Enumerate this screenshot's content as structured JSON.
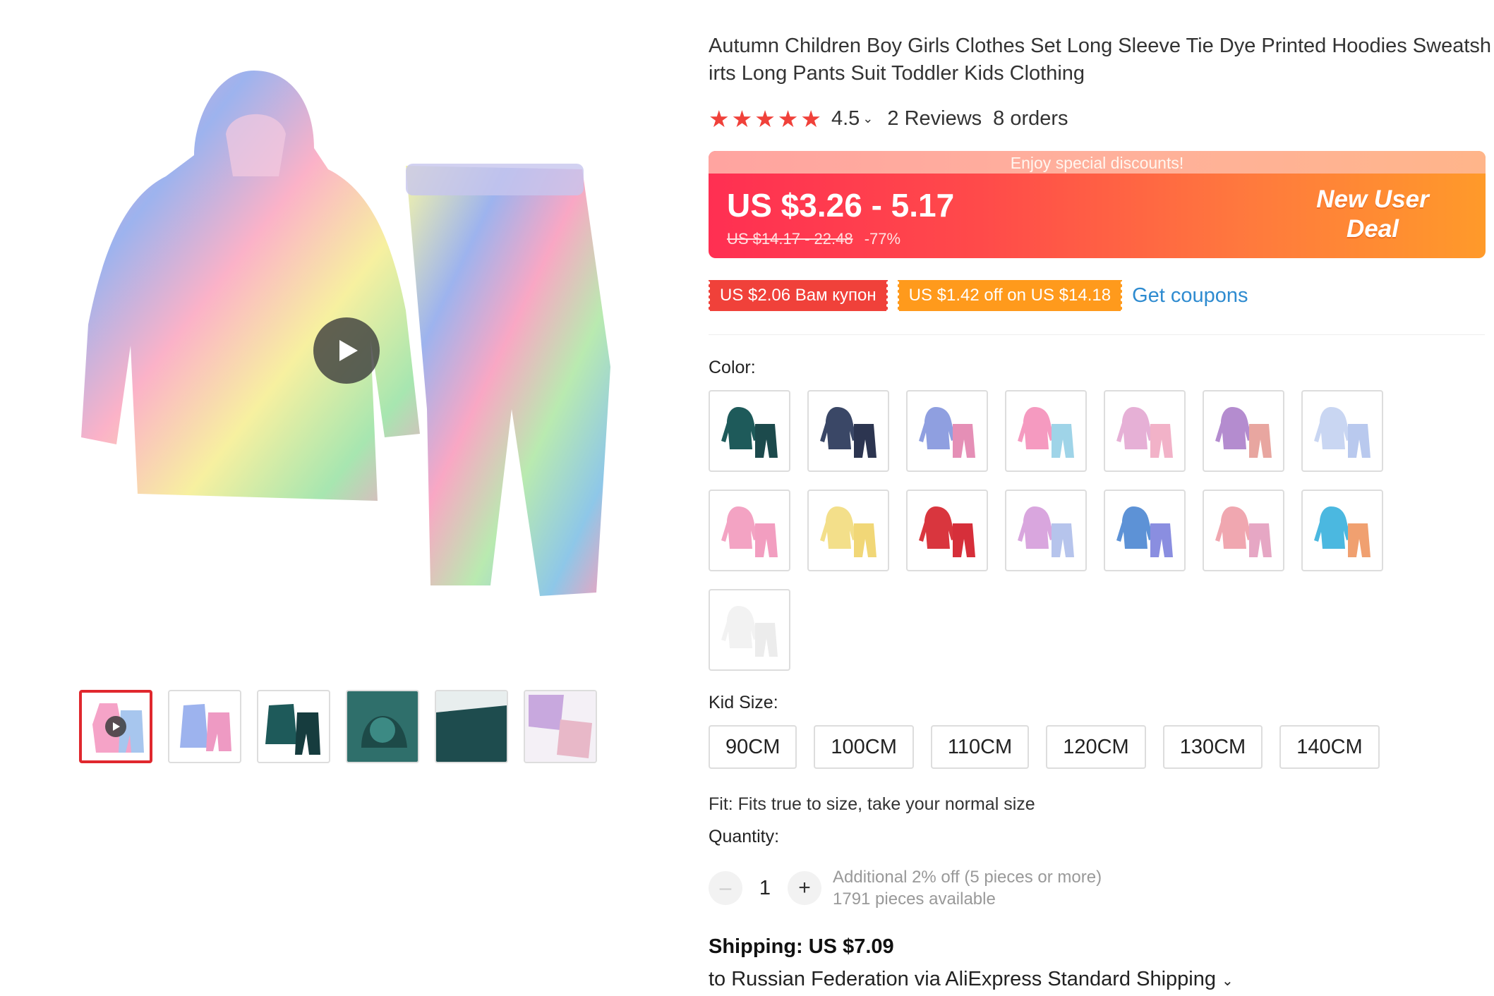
{
  "product": {
    "title_line1": "Autumn Children Boy Girls Clothes Set Long Sleeve Tie Dye Printed Hoodies Sweatsh",
    "title_line2": "irts Long Pants Suit Toddler Kids Clothing"
  },
  "rating": {
    "value": "4.5",
    "stars": 5,
    "reviews": "2 Reviews",
    "orders": "8 orders"
  },
  "price": {
    "banner_top": "Enjoy special discounts!",
    "current": "US $3.26 - 5.17",
    "original": "US $14.17 - 22.48",
    "discount": "-77%",
    "badge_line1": "New User",
    "badge_line2": "Deal"
  },
  "coupons": {
    "coupon1": "US $2.06 Вам купон",
    "coupon2": "US $1.42 off on US $14.18",
    "get_coupons": "Get coupons"
  },
  "color": {
    "label": "Color:",
    "swatches": [
      {
        "name": "dark-green",
        "hood": "#1e5a5a",
        "pants": "#1c4a4c"
      },
      {
        "name": "navy",
        "hood": "#3a4766",
        "pants": "#2c3550"
      },
      {
        "name": "blue-pink",
        "hood": "#8f9fe0",
        "pants": "#e58fb6"
      },
      {
        "name": "rainbow",
        "hood": "#f59ac0",
        "pants": "#9fd4e8"
      },
      {
        "name": "pastel-pink",
        "hood": "#e6b0d6",
        "pants": "#f2b2c8"
      },
      {
        "name": "purple-pink",
        "hood": "#b48ccf",
        "pants": "#e8a6a0"
      },
      {
        "name": "light-blue",
        "hood": "#c9d6f2",
        "pants": "#b9c9ee"
      },
      {
        "name": "pink",
        "hood": "#f3a3c3",
        "pants": "#f29ec0"
      },
      {
        "name": "yellow",
        "hood": "#f3df8a",
        "pants": "#f1d777"
      },
      {
        "name": "red",
        "hood": "#d9363e",
        "pants": "#d62f3a"
      },
      {
        "name": "lilac",
        "hood": "#d9a6de",
        "pants": "#b6c4ec"
      },
      {
        "name": "blue",
        "hood": "#5d92d6",
        "pants": "#8a8ee0"
      },
      {
        "name": "peach",
        "hood": "#f0a7b0",
        "pants": "#e6a7c4"
      },
      {
        "name": "multicolor",
        "hood": "#4bb8e0",
        "pants": "#f0a070"
      },
      {
        "name": "white",
        "hood": "#f2f2f2",
        "pants": "#ececec"
      }
    ]
  },
  "size": {
    "label": "Kid Size:",
    "options": [
      "90CM",
      "100CM",
      "110CM",
      "120CM",
      "130CM",
      "140CM"
    ]
  },
  "fit": "Fit: Fits true to size, take your normal size",
  "quantity": {
    "label": "Quantity:",
    "value": "1",
    "minus": "–",
    "plus": "+",
    "note1": "Additional 2% off (5 pieces or more)",
    "note2": "1791 pieces available"
  },
  "shipping": {
    "title": "Shipping: US $7.09",
    "detail": "to Russian Federation via AliExpress Standard Shipping"
  },
  "gallery": {
    "thumbnails": [
      "thumb-video",
      "thumb-blue-pink",
      "thumb-dark-green",
      "thumb-hood-closeup",
      "thumb-pants-closeup",
      "thumb-pastel"
    ]
  },
  "colors": {
    "accent": "#f0413a",
    "link": "#2e8bd0",
    "coupon_orange": "#ff9a1c"
  }
}
